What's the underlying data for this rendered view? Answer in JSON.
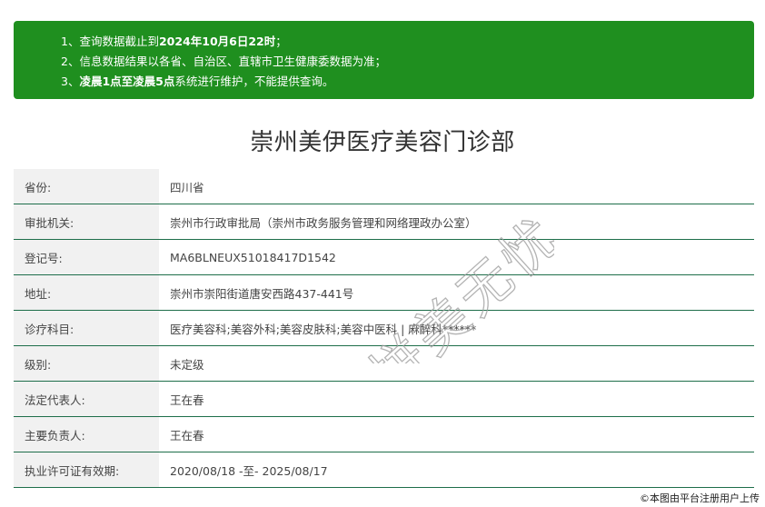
{
  "notice": {
    "line1_prefix": "1、查询数据截止到",
    "line1_bold": "2024年10月6日22时",
    "line1_suffix": "；",
    "line2": "2、信息数据结果以各省、自治区、直辖市卫生健康委数据为准；",
    "line3_prefix": "3、",
    "line3_bold": "凌晨1点至凌晨5点",
    "line3_suffix": "系统进行维护，不能提供查询。",
    "bg_color": "#1f8f1f"
  },
  "title": "崇州美伊医疗美容门诊部",
  "rows": [
    {
      "label": "省份:",
      "value": "四川省"
    },
    {
      "label": "审批机关:",
      "value": "崇州市行政审批局（崇州市政务服务管理和网络理政办公室）"
    },
    {
      "label": "登记号:",
      "value": "MA6BLNEUX51018417D1542"
    },
    {
      "label": "地址:",
      "value": "崇州市崇阳街道唐安西路437-441号"
    },
    {
      "label": "诊疗科目:",
      "value": "医疗美容科;美容外科;美容皮肤科;美容中医科 | 麻醉科******"
    },
    {
      "label": "级别:",
      "value": "未定级"
    },
    {
      "label": "法定代表人:",
      "value": "王在春"
    },
    {
      "label": "主要负责人:",
      "value": "王在春"
    },
    {
      "label": "执业许可证有效期:",
      "value": "2020/08/18 -至- 2025/08/17"
    }
  ],
  "watermark": "拼美无忧",
  "credit": "©本图由平台注册用户上传",
  "colors": {
    "row_border": "#1e6e4a",
    "label_bg": "#f1f1f1"
  }
}
